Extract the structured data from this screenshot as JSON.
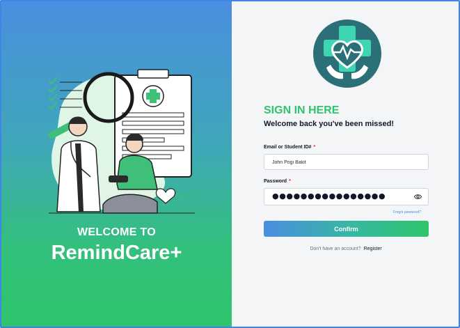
{
  "left": {
    "welcome_line": "WELCOME TO",
    "brand_name": "RemindCare+",
    "illustration": "doctor-checking-patient-blood-pressure-illustration"
  },
  "right": {
    "logo_icon": "heart-cross-hands-logo",
    "title": "SIGN IN HERE",
    "subtitle": "Welcome back you've been missed!",
    "email": {
      "label": "Email or Student ID#",
      "required_mark": "*",
      "value": "John Pogi Bakit"
    },
    "password": {
      "label": "Password",
      "required_mark": "*",
      "masked_value": "●●●●●●●●●●●●●●●●",
      "toggle_icon": "eye-icon"
    },
    "forgot_link": "Forgot password?",
    "confirm_label": "Confirm",
    "no_account_text": "Don't have an account?",
    "register_link": "Register"
  },
  "colors": {
    "accent_green": "#2fc46d",
    "accent_blue": "#4a8ee0",
    "logo_teal": "#2b6f78",
    "required_red": "#e02424"
  }
}
